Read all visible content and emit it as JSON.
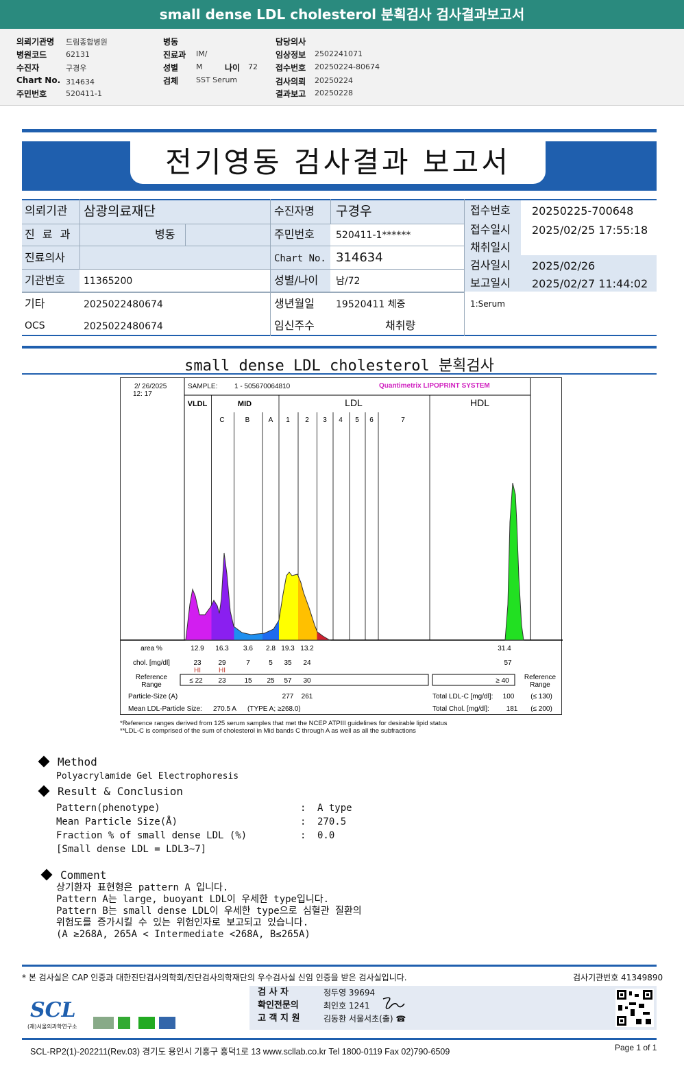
{
  "header": {
    "title": "small dense LDL cholesterol 분획검사 검사결과보고서"
  },
  "info": {
    "col1": [
      {
        "label": "의뢰기관명",
        "value": "드림종합병원"
      },
      {
        "label": "병원코드",
        "value": "62131"
      },
      {
        "label": "수진자",
        "value": "구경우"
      },
      {
        "label": "Chart No.",
        "value": "314634"
      },
      {
        "label": "주민번호",
        "value": "520411-1"
      }
    ],
    "col2": [
      {
        "label": "병동",
        "value": ""
      },
      {
        "label": "진료과",
        "value": "IM/"
      },
      {
        "label": "성별",
        "value": "M"
      },
      {
        "label": "검체",
        "value": "SST Serum"
      }
    ],
    "age": {
      "label": "나이",
      "value": "72"
    },
    "col3": [
      {
        "label": "담당의사",
        "value": ""
      },
      {
        "label": "임상정보",
        "value": "2502241071"
      },
      {
        "label": "접수번호",
        "value": "20250224-80674"
      },
      {
        "label": "검사의뢰",
        "value": "20250224"
      },
      {
        "label": "결과보고",
        "value": "20250228"
      }
    ]
  },
  "report": {
    "title": "전기영동 검사결과 보고서"
  },
  "table": {
    "r1": {
      "l1": "의뢰기관",
      "v1": "삼광의료재단",
      "l2": "수진자명",
      "v2": "구경우"
    },
    "r2": {
      "l1": "진 료 과",
      "v1": "병동",
      "l2": "주민번호",
      "v2": "520411-1******"
    },
    "r3": {
      "l1": "진료의사",
      "v1": "",
      "l2": "Chart No.",
      "v2": "314634"
    },
    "r4": {
      "l1": "기관번호",
      "v1": "11365200",
      "l2": "성별/나이",
      "v2": "남/72"
    },
    "r5": {
      "l1": "기타",
      "v1": "2025022480674",
      "l2": "생년월일",
      "v2": "19520411 체중"
    },
    "r6": {
      "l1": "OCS",
      "v1": "2025022480674",
      "l2": "임신주수",
      "v2": "채취량"
    },
    "right": [
      {
        "label": "접수번호",
        "value": "20250225-700648"
      },
      {
        "label": "접수일시",
        "value": "2025/02/25 17:55:18"
      },
      {
        "label": "채취일시",
        "value": ""
      },
      {
        "label": "검사일시",
        "value": "2025/02/26"
      },
      {
        "label": "보고일시",
        "value": "2025/02/27 11:44:02"
      }
    ],
    "specimen": "1:Serum"
  },
  "section_title": "small dense LDL cholesterol 분획검사",
  "chart_data": {
    "type": "area",
    "date": "2/ 26/2025",
    "time": "12: 17",
    "sample_label": "SAMPLE:",
    "sample": "1 - 505670064810",
    "brand": "Quantimetrix LIPOPRINT SYSTEM",
    "groups": [
      "VLDL",
      "MID",
      "LDL",
      "HDL"
    ],
    "bands": [
      "C",
      "B",
      "A",
      "1",
      "2",
      "3",
      "4",
      "5",
      "6",
      "7"
    ],
    "band_colors": {
      "VLDL": "#d21ef0",
      "C": "#8a1ff0",
      "B": "#1e8ff0",
      "A": "#1e6af0",
      "1": "#ffff00",
      "2": "#ffc000",
      "3": "#d02030",
      "HDL": "#22e022"
    },
    "rows": {
      "area_label": "area %",
      "area": [
        "12.9",
        "16.3",
        "3.6",
        "2.8",
        "19.3",
        "13.2"
      ],
      "area_hdl": "31.4",
      "chol_label": "chol. [mg/dl]",
      "chol": [
        "23",
        "29",
        "7",
        "5",
        "35",
        "24"
      ],
      "chol_hdl": "57",
      "flags": [
        "HI",
        "HI"
      ],
      "ref_label": "Reference Range",
      "ref": [
        "≤ 22",
        "23",
        "15",
        "25",
        "57",
        "30"
      ],
      "ref_hdl": "≥ 40",
      "ref_label_right": "Reference Range",
      "particle_label": "Particle-Size (A)",
      "particle": [
        "277",
        "261"
      ],
      "mean_label": "Mean LDL-Particle Size:",
      "mean": "270.5 A",
      "mean_type": "(TYPE A; ≥268.0)",
      "total_ldl_label": "Total LDL-C [mg/dl]:",
      "total_ldl": "100",
      "total_ldl_ref": "(≤ 130)",
      "total_chol_label": "Total Chol. [mg/dl]:",
      "total_chol": "181",
      "total_chol_ref": "(≤ 200)"
    }
  },
  "footnotes": [
    "*Reference ranges derived from 125 serum samples that met the NCEP ATPIII guidelines for desirable lipid status",
    "**LDL-C is comprised of the sum of cholesterol in Mid bands C through A as well as all the subfractions"
  ],
  "method": {
    "title": "Method",
    "text": "Polyacrylamide Gel Electrophoresis"
  },
  "result": {
    "title": "Result & Conclusion",
    "items": [
      {
        "label": "Pattern(phenotype)",
        "value": "A type"
      },
      {
        "label": "Mean Particle Size(Å)",
        "value": "270.5"
      },
      {
        "label": "Fraction % of small dense LDL (%)",
        "value": "0.0"
      }
    ],
    "note": "[Small dense LDL = LDL3~7]"
  },
  "comment": {
    "title": "Comment",
    "lines": [
      "상기환자 표현형은 pattern A 입니다.",
      "Pattern A는 large, buoyant LDL이 우세한 type입니다.",
      "Pattern B는 small dense LDL이 우세한 type으로 심혈관 질환의",
      "위험도를 증가시킬 수 있는 위험인자로 보고되고 있습니다.",
      "(A ≥268A, 265A < Intermediate <268A, B≤265A)"
    ]
  },
  "footer": {
    "cert": "* 본 검사실은 CAP 인증과 대한진단검사의학회/진단검사의학재단의 우수검사실 신임 인증을 받은 검사실입니다.",
    "lab_no": "검사기관번호 41349890",
    "logo": "SCL",
    "logo_sub": "(재)서울의과학연구소",
    "staff": [
      {
        "role": "검 사 자",
        "value": "정두영 39694"
      },
      {
        "role": "확인전문의",
        "value": "최인호 1241"
      },
      {
        "role": "고 객 지 원",
        "value": "김동환 서울서초(출) ☎"
      }
    ],
    "address": "SCL-RP2(1)-202211(Rev.03)  경기도 용인시 기흥구 흥덕1로 13  www.scllab.co.kr  Tel 1800-0119  Fax 02)790-6509",
    "page": "Page 1 of 1"
  }
}
